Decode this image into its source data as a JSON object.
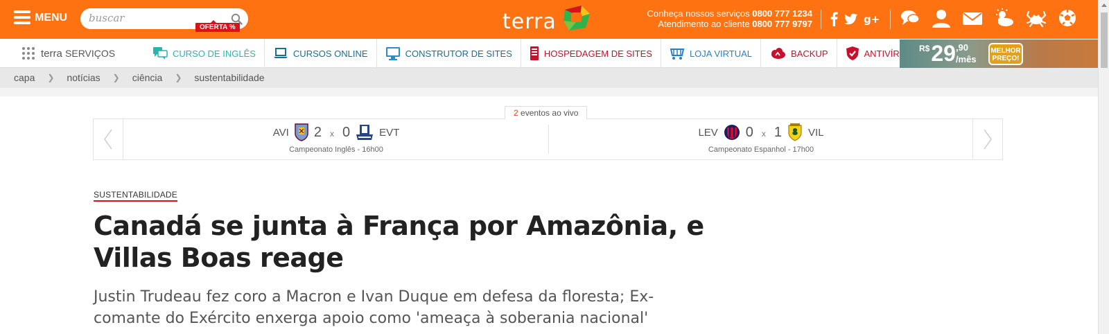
{
  "header": {
    "menu_label": "MENU",
    "search_placeholder": "buscar",
    "logo_text": "terra",
    "contact_line1_text": "Conheça nossos serviços",
    "contact_line1_phone": "0800 777 1234",
    "contact_line2_text": "Atendimento ao cliente",
    "contact_line2_phone": "0800 777 9797",
    "social_icons": [
      "facebook-icon",
      "twitter-icon",
      "google-plus-icon"
    ],
    "tool_icons": [
      "chat-icon",
      "user-icon",
      "mail-icon",
      "weather-icon",
      "horoscope-icon",
      "soccer-icon"
    ],
    "accent_color": "#ff7212"
  },
  "services": {
    "brand_prefix": "terra",
    "brand_suffix": "SERVIÇOS",
    "items": [
      {
        "label": "CURSO DE INGLÊS",
        "color": "#2bb3b1",
        "icon": "chat-bubble-icon"
      },
      {
        "label": "CURSOS ONLINE",
        "color": "#1a6e94",
        "icon": "laptop-icon"
      },
      {
        "label": "CONSTRUTOR DE SITES",
        "color": "#1a6e94",
        "icon": "monitor-icon"
      },
      {
        "label": "HOSPEDAGEM DE SITES",
        "color": "#c8102e",
        "icon": "server-icon"
      },
      {
        "label": "LOJA VIRTUAL",
        "color": "#2a7fc1",
        "icon": "cart-icon"
      },
      {
        "label": "BACKUP",
        "color": "#c8102e",
        "icon": "cloud-icon"
      },
      {
        "label": "ANTIVÍRUS",
        "color": "#c8102e",
        "icon": "shield-icon"
      }
    ],
    "offer_badge": "OFERTA %",
    "ad": {
      "currency": "R$",
      "price_big": "29",
      "price_cents": ",90",
      "price_unit": "/mês",
      "badge_line1": "MELHOR",
      "badge_line2": "PREÇO!"
    }
  },
  "breadcrumb": [
    "capa",
    "notícias",
    "ciência",
    "sustentabilidade"
  ],
  "live": {
    "count": "2",
    "label": "eventos ao vivo",
    "matches": [
      {
        "home": "AVI",
        "home_score": "2",
        "away_score": "0",
        "away": "EVT",
        "separator": "x",
        "competition": "Campeonato Inglês - 16h00"
      },
      {
        "home": "LEV",
        "home_score": "0",
        "away_score": "1",
        "away": "VIL",
        "separator": "x",
        "competition": "Campeonato Espanhol - 17h00"
      }
    ]
  },
  "article": {
    "section": "SUSTENTABILIDADE",
    "headline": "Canadá se junta à França por Amazônia, e Villas Boas reage",
    "subtitle": "Justin Trudeau fez coro a Macron e Ivan Duque em defesa da floresta; Ex-comante do Exército enxerga apoio como 'ameaça à soberania nacional'"
  }
}
